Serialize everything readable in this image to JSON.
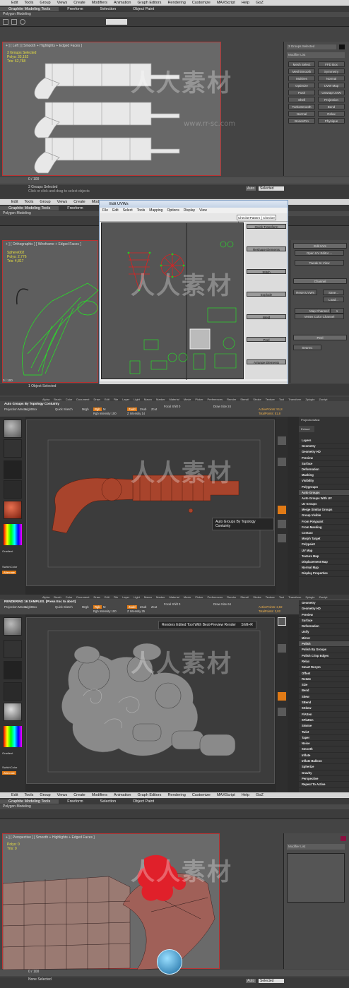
{
  "watermark": {
    "text": "人人素材",
    "url": "www.rr-sc.com"
  },
  "max1": {
    "menu": [
      "Edit",
      "Tools",
      "Group",
      "Views",
      "Create",
      "Modifiers",
      "Animation",
      "Graph Editors",
      "Rendering",
      "Customize",
      "MAXScript",
      "Help",
      "GoZ"
    ],
    "ribbon": [
      "Graphite Modeling Tools",
      "Freeform",
      "Selection",
      "Object Paint"
    ],
    "subribbon": "Polygon Modeling",
    "viewport_label": "+ ] [ Left ] [ Smooth + Highlights + Edged Faces ]",
    "stats": [
      "3 Groups Selected",
      "Polys: 33,162",
      "Tris: 62,768"
    ],
    "modifier_list": "Modifier List",
    "group_label": "3 Groups Selected",
    "buttons": [
      "Mesh Select",
      "FFD Box",
      "MeshSmooth",
      "Symmetry",
      "Multires",
      "Normal",
      "Optimize",
      "UVW Map",
      "Push",
      "Unwrap UVW",
      "Shell",
      "Projection",
      "TurboSmooth",
      "Bend",
      "Normal",
      "Relax",
      "BonesPro",
      "Physique"
    ],
    "status": "3 Groups Selected",
    "prompt": "Click or click-and-drag to select objects",
    "frame": "0 / 100",
    "auto": "Auto",
    "selected": "Selected"
  },
  "max2": {
    "menu": [
      "Edit",
      "Tools",
      "Group",
      "Views",
      "Create",
      "Modifiers",
      "Animation",
      "Graph Editors",
      "Rendering",
      "Customize",
      "MAXScript",
      "Help",
      "GoZ"
    ],
    "ribbon": [
      "Graphite Modeling Tools",
      "Freeform"
    ],
    "subribbon": "Polygon Modeling",
    "viewport_label": "+ ] [ Orthographic ] [ Wireframe + Edged Faces ]",
    "stats": [
      "Sphere002",
      "Polys: 2,776",
      "Tris: 4,817"
    ],
    "uvw_title": "Edit UVWs",
    "uvw_menu": [
      "File",
      "Edit",
      "Select",
      "Tools",
      "Mapping",
      "Options",
      "Display",
      "View"
    ],
    "uvw_pattern": "CheckerPattern ( Checker )",
    "uvw_rollouts": [
      "Quick Transform",
      "Reshape Elements",
      "Stitch",
      "Explode",
      "Weld",
      "Peel",
      "Arrange Elements"
    ],
    "uvw_dropdown": "All IDs",
    "right_rollouts": [
      "Edit UVs",
      "Open UV Editor ...",
      "Tweak In View",
      "Channel",
      "Reset UVWs",
      "Save...",
      "Load...",
      "Map Channel:",
      "Vertex Color Channel",
      "Peel",
      "Seams:"
    ],
    "channel_value": "1",
    "status": "1 Object Selected",
    "frame": "0 / 100"
  },
  "zb1": {
    "menu": [
      "Alpha",
      "Brush",
      "Color",
      "Document",
      "Draw",
      "Edit",
      "File",
      "Layer",
      "Light",
      "Macro",
      "Marker",
      "Material",
      "Movie",
      "Picker",
      "Preferences",
      "Render",
      "Stencil",
      "Stroke",
      "Texture",
      "Tool",
      "Transform",
      "Zplugin",
      "Zscript"
    ],
    "header": "Auto Groups By Topology Contuinty",
    "top_controls": [
      "Projection Master",
      "LightBox",
      "Quick Sketch",
      "Mrgb",
      "Rgb",
      "M",
      "Zadd",
      "Zsub",
      "Zcut",
      "Focal Shift 0",
      "Draw Size 24",
      "Rgb Intensity 100",
      "Z Intensity 14"
    ],
    "active_points": "ActivePoints: 51,8",
    "total_points": "TotalPoints: 51,8",
    "tooltip": "Auto Groups By Topology Contuinty",
    "right_items": [
      "Layers",
      "Geometry",
      "Geometry HD",
      "Preview",
      "Surface",
      "Deformation",
      "Masking",
      "Visibility",
      "Polygroups",
      "Auto Groups",
      "Auto Groups With UV",
      "Uv Groups",
      "Merge Similar Groups",
      "Group Visible",
      "From Polypaint",
      "From Masking",
      "Contact",
      "Morph Target",
      "Polypaint",
      "UV Map",
      "Texture Map",
      "Displacement Map",
      "Normal Map",
      "Display Properties"
    ],
    "left_labels": [
      "Gradient",
      "SwitchColor",
      "Alternate"
    ],
    "projection_label": "ProjectionMast",
    "extract": "Extract"
  },
  "zb2": {
    "menu": [
      "Alpha",
      "Brush",
      "Color",
      "Document",
      "Draw",
      "Edit",
      "File",
      "Layer",
      "Light",
      "Macro",
      "Marker",
      "Material",
      "Movie",
      "Picker",
      "Preferences",
      "Render",
      "Stencil",
      "Stroke",
      "Texture",
      "Tool",
      "Transform",
      "Zplugin",
      "Zscript"
    ],
    "header": "RENDERING 16 SAMPLES. (Press Esc to abort)",
    "top_controls": [
      "Projection Master",
      "LightBox",
      "Quick Sketch",
      "Mrgb",
      "Rgb",
      "M",
      "Zadd",
      "Zsub",
      "Zcut",
      "Focal Shift 0",
      "Draw Size 64",
      "Rgb Intensity 100",
      "Z Intensity 25"
    ],
    "active_points": "ActivePoints: 2,82",
    "total_points": "TotalPoints: 2,82",
    "tooltip": "Renders Edited Tool With Best-Preview Render",
    "tooltip_key": "Shift+R",
    "right_items": [
      "Geometry",
      "Geometry HD",
      "Preview",
      "Surface",
      "Deformation",
      "Unify",
      "Mirror",
      "Polish",
      "Polish By Groups",
      "Polish Crisp Edges",
      "Relax",
      "Smart Resym",
      "Offset",
      "Rotate",
      "Size",
      "Bend",
      "Skew",
      "SBend",
      "SSkew",
      "FlAtten",
      "SFlatten",
      "SNoise",
      "Twist",
      "Taper",
      "Noise",
      "Smooth",
      "Inflate",
      "Inflate Balloon",
      "Spherize",
      "Gravity",
      "Perspective",
      "Repeat To Active"
    ],
    "left_labels": [
      "Gradient",
      "SwitchColor",
      "Alternate"
    ]
  },
  "max3": {
    "menu": [
      "Edit",
      "Tools",
      "Group",
      "Views",
      "Create",
      "Modifiers",
      "Animation",
      "Graph Editors",
      "Rendering",
      "Customize",
      "MAXScript",
      "Help",
      "GoZ"
    ],
    "ribbon": [
      "Graphite Modeling Tools",
      "Freeform",
      "Selection",
      "Object Paint"
    ],
    "subribbon": "Polygon Modeling",
    "viewport_label": "+ ] [ Perspective ] [ Smooth + Highlights + Edged Faces ]",
    "stats": [
      "Polys: 0",
      "Tris: 0"
    ],
    "modifier_list": "Modifier List",
    "status": "None Selected",
    "frame": "0 / 100",
    "auto": "Auto",
    "selected": "Selected"
  },
  "colors": {
    "accent_orange": "#e07a16",
    "max_border": "#b33333",
    "zb_red": "#d04020",
    "selected_red": "#e0202a",
    "wire_green": "#22ee22"
  }
}
